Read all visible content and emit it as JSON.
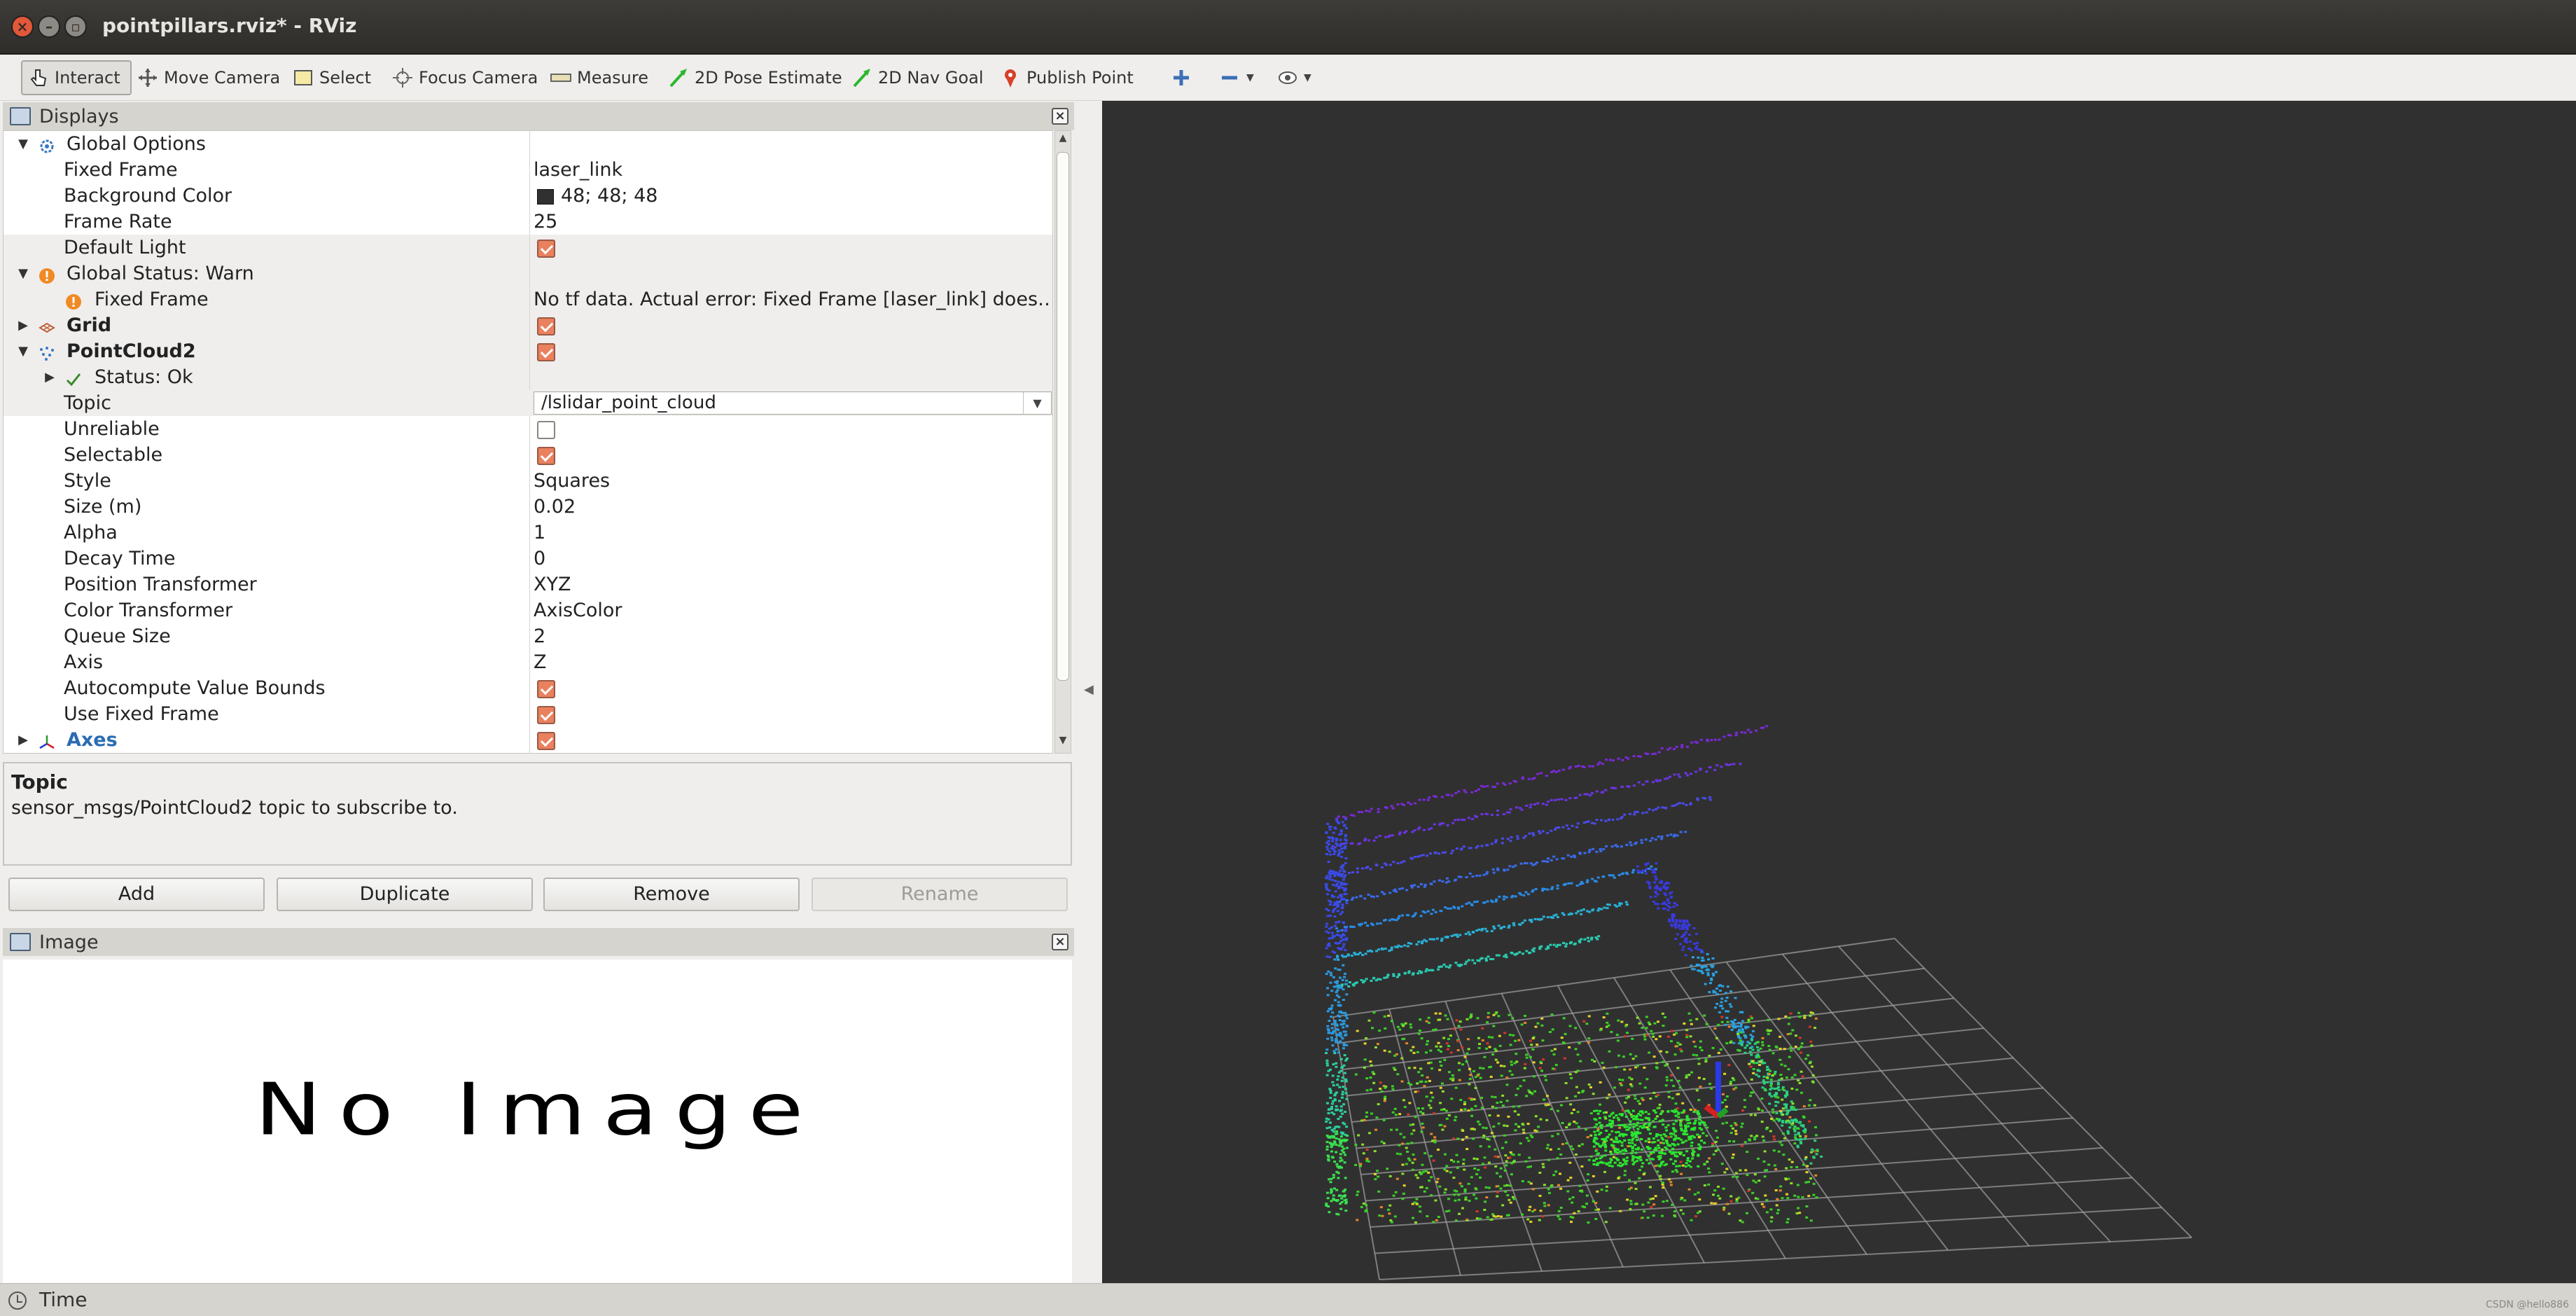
{
  "window": {
    "title": "pointpillars.rviz* - RViz"
  },
  "toolbar": {
    "tools": [
      {
        "label": "Interact",
        "icon": "hand-cursor-icon",
        "active": true
      },
      {
        "label": "Move Camera",
        "icon": "move-camera-icon"
      },
      {
        "label": "Select",
        "icon": "select-rectangle-icon"
      },
      {
        "label": "Focus Camera",
        "icon": "focus-target-icon"
      },
      {
        "label": "Measure",
        "icon": "ruler-icon"
      },
      {
        "label": "2D Pose Estimate",
        "icon": "green-arrow-icon"
      },
      {
        "label": "2D Nav Goal",
        "icon": "green-arrow-icon"
      },
      {
        "label": "Publish Point",
        "icon": "map-pin-icon"
      }
    ]
  },
  "displays_panel": {
    "title": "Displays",
    "rows": {
      "global_options": "Global Options",
      "fixed_frame": {
        "label": "Fixed Frame",
        "value": "laser_link"
      },
      "background_color": {
        "label": "Background Color",
        "value": "48; 48; 48",
        "swatch": "#303030"
      },
      "frame_rate": {
        "label": "Frame Rate",
        "value": "25"
      },
      "default_light": {
        "label": "Default Light",
        "checked": true
      },
      "global_status": "Global Status: Warn",
      "fixed_frame_warn": {
        "label": "Fixed Frame",
        "value": "No tf data.  Actual error: Fixed Frame [laser_link] does…"
      },
      "grid": {
        "label": "Grid",
        "checked": true
      },
      "pointcloud2": {
        "label": "PointCloud2",
        "checked": true
      },
      "status_ok": "Status: Ok",
      "topic": {
        "label": "Topic",
        "value": "/lslidar_point_cloud"
      },
      "unreliable": {
        "label": "Unreliable",
        "checked": false
      },
      "selectable": {
        "label": "Selectable",
        "checked": true
      },
      "style": {
        "label": "Style",
        "value": "Squares"
      },
      "size": {
        "label": "Size (m)",
        "value": "0.02"
      },
      "alpha": {
        "label": "Alpha",
        "value": "1"
      },
      "decay_time": {
        "label": "Decay Time",
        "value": "0"
      },
      "position_transformer": {
        "label": "Position Transformer",
        "value": "XYZ"
      },
      "color_transformer": {
        "label": "Color Transformer",
        "value": "AxisColor"
      },
      "queue_size": {
        "label": "Queue Size",
        "value": "2"
      },
      "axis": {
        "label": "Axis",
        "value": "Z"
      },
      "autocompute": {
        "label": "Autocompute Value Bounds",
        "checked": true
      },
      "use_fixed_frame": {
        "label": "Use Fixed Frame",
        "checked": true
      },
      "axes": {
        "label": "Axes",
        "checked": true
      }
    },
    "description": {
      "title": "Topic",
      "text": "sensor_msgs/PointCloud2 topic to subscribe to."
    },
    "buttons": {
      "add": "Add",
      "duplicate": "Duplicate",
      "remove": "Remove",
      "rename": "Rename"
    }
  },
  "image_panel": {
    "title": "Image",
    "placeholder": "No Image"
  },
  "viewport": {
    "background": "#303030",
    "grid_color": "#a0a0a0"
  },
  "statusbar": {
    "time_label": "Time",
    "watermark": "CSDN @hello886"
  }
}
